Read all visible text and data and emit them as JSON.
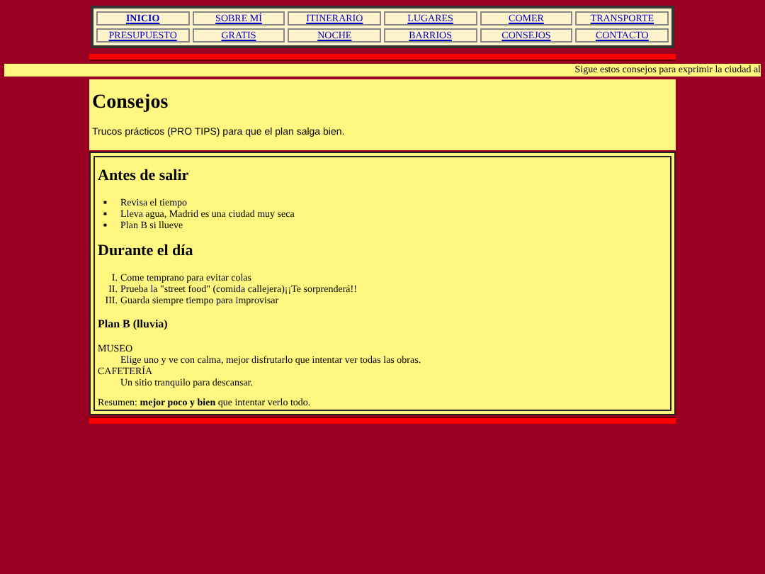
{
  "nav": [
    {
      "label": "INICIO",
      "selected": true
    },
    {
      "label": "SOBRE MÍ",
      "selected": false
    },
    {
      "label": "ITINERARIO",
      "selected": false
    },
    {
      "label": "LUGARES",
      "selected": false
    },
    {
      "label": "COMER",
      "selected": false
    },
    {
      "label": "TRANSPORTE",
      "selected": false
    },
    {
      "label": "PRESUPUESTO",
      "selected": false
    },
    {
      "label": "GRATIS",
      "selected": false
    },
    {
      "label": "NOCHE",
      "selected": false
    },
    {
      "label": "BARRIOS",
      "selected": false
    },
    {
      "label": "CONSEJOS",
      "selected": false
    },
    {
      "label": "CONTACTO",
      "selected": false
    }
  ],
  "marquee": "Sigue estos consejos para exprimir la ciudad al",
  "title": "Consejos",
  "intro": "Trucos prácticos (PRO TIPS) para que el plan salga bien.",
  "content": [
    {
      "kind": "heading",
      "text": "Antes de salir"
    },
    {
      "kind": "bullets",
      "items": [
        {
          "marker": "■",
          "text": "Revisa el tiempo"
        },
        {
          "marker": "■",
          "text": "Lleva agua, Madrid es una ciudad muy seca"
        },
        {
          "marker": "■",
          "text": "Plan B si llueve"
        }
      ]
    },
    {
      "kind": "heading",
      "text": "Durante el día"
    },
    {
      "kind": "numbered",
      "items": [
        {
          "marker": "I.",
          "text": "Come temprano para evitar colas"
        },
        {
          "marker": "II.",
          "text": "Prueba la \"street food\" (comida callejera)¡¡Te sorprenderá!!"
        },
        {
          "marker": "III.",
          "text": "Guarda siempre tiempo para improvisar"
        }
      ]
    },
    {
      "kind": "subheading",
      "text": "Plan B (lluvia)"
    },
    {
      "kind": "definitions",
      "items": [
        {
          "term": "MUSEO",
          "description": "Elige uno y ve con calma, mejor disfrutarlo que intentar ver todas las obras."
        },
        {
          "term": "CAFETERÍA",
          "description": "Un sitio tranquilo para descansar."
        }
      ]
    },
    {
      "kind": "paragraph",
      "text": "Resumen: **mejor poco y bien** que intentar verlo todo."
    }
  ]
}
